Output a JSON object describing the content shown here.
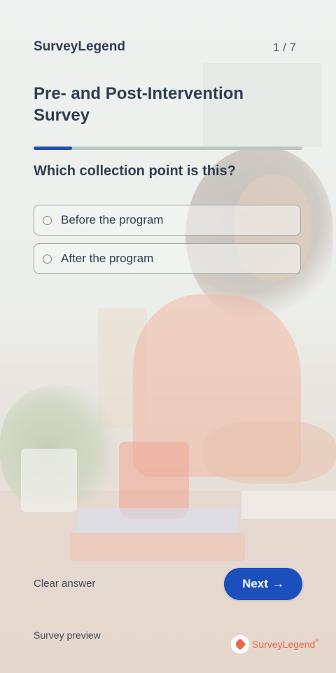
{
  "header": {
    "brand": "SurveyLegend",
    "counter": "1 / 7"
  },
  "survey": {
    "title": "Pre- and Post-Intervention Survey",
    "progress": 0.143
  },
  "question": {
    "text": "Which collection point is this?",
    "options": [
      {
        "label": "Before the program",
        "selected": false
      },
      {
        "label": "After the program",
        "selected": false
      }
    ]
  },
  "footer": {
    "clear_label": "Clear answer",
    "next_label": "Next",
    "next_arrow": "→",
    "preview_label": "Survey preview",
    "logo_text": "SurveyLegend",
    "logo_tm": "®"
  },
  "colors": {
    "accent": "#1d4fbc",
    "text": "#2f3e52",
    "brand": "#e9674a"
  },
  "icons": {
    "next_arrow": "arrow-right-icon",
    "logo_mark": "surveylegend-logo-icon"
  }
}
